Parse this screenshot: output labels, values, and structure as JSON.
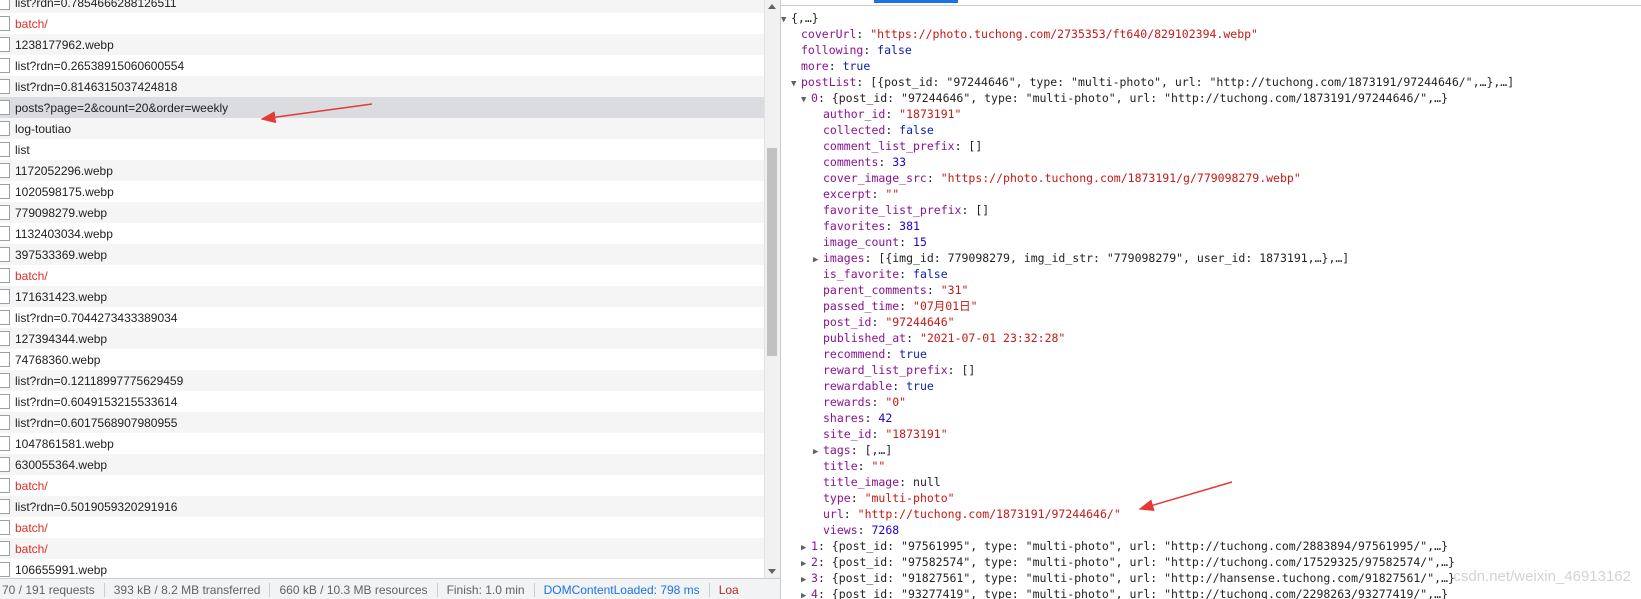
{
  "requests": [
    {
      "name": "list?rdn=0.7854666288126511"
    },
    {
      "name": "batch/",
      "red": true
    },
    {
      "name": "1238177962.webp"
    },
    {
      "name": "list?rdn=0.26538915060600554"
    },
    {
      "name": "list?rdn=0.8146315037424818"
    },
    {
      "name": "posts?page=2&count=20&order=weekly",
      "selected": true
    },
    {
      "name": "log-toutiao"
    },
    {
      "name": "list"
    },
    {
      "name": "1172052296.webp"
    },
    {
      "name": "1020598175.webp"
    },
    {
      "name": "779098279.webp"
    },
    {
      "name": "1132403034.webp"
    },
    {
      "name": "397533369.webp"
    },
    {
      "name": "batch/",
      "red": true
    },
    {
      "name": "171631423.webp"
    },
    {
      "name": "list?rdn=0.7044273433389034"
    },
    {
      "name": "127394344.webp"
    },
    {
      "name": "74768360.webp"
    },
    {
      "name": "list?rdn=0.12118997775629459"
    },
    {
      "name": "list?rdn=0.6049153215533614"
    },
    {
      "name": "list?rdn=0.6017568907980955"
    },
    {
      "name": "1047861581.webp"
    },
    {
      "name": "630055364.webp"
    },
    {
      "name": "batch/",
      "red": true
    },
    {
      "name": "list?rdn=0.5019059320291916"
    },
    {
      "name": "batch/",
      "red": true
    },
    {
      "name": "batch/",
      "red": true
    },
    {
      "name": "106655991.webp"
    }
  ],
  "status_bar": {
    "requests": "70 / 191 requests",
    "transferred": "393 kB / 8.2 MB transferred",
    "resources": "660 kB / 10.3 MB resources",
    "finish": "Finish: 1.0 min",
    "dom_content_loaded": "DOMContentLoaded: 798 ms",
    "load": "Loa"
  },
  "json_lines": [
    {
      "indent": 0,
      "toggle": "▼",
      "key": "",
      "value": "{,…}",
      "vclass": ""
    },
    {
      "indent": 1,
      "toggle": "",
      "key": "coverUrl",
      "value": "\"https://photo.tuchong.com/2735353/ft640/829102394.webp\"",
      "vclass": "str"
    },
    {
      "indent": 1,
      "toggle": "",
      "key": "following",
      "value": "false",
      "vclass": "kw"
    },
    {
      "indent": 1,
      "toggle": "",
      "key": "more",
      "value": "true",
      "vclass": "kw"
    },
    {
      "indent": 1,
      "toggle": "▼",
      "key": "postList",
      "value": "[{post_id: \"97244646\", type: \"multi-photo\", url: \"http://tuchong.com/1873191/97244646/\",…},…]",
      "vclass": ""
    },
    {
      "indent": 2,
      "toggle": "▼",
      "key": "0",
      "value": "{post_id: \"97244646\", type: \"multi-photo\", url: \"http://tuchong.com/1873191/97244646/\",…}",
      "vclass": ""
    },
    {
      "indent": 3,
      "toggle": "",
      "key": "author_id",
      "value": "\"1873191\"",
      "vclass": "str"
    },
    {
      "indent": 3,
      "toggle": "",
      "key": "collected",
      "value": "false",
      "vclass": "kw"
    },
    {
      "indent": 3,
      "toggle": "",
      "key": "comment_list_prefix",
      "value": "[]",
      "vclass": ""
    },
    {
      "indent": 3,
      "toggle": "",
      "key": "comments",
      "value": "33",
      "vclass": "num"
    },
    {
      "indent": 3,
      "toggle": "",
      "key": "cover_image_src",
      "value": "\"https://photo.tuchong.com/1873191/g/779098279.webp\"",
      "vclass": "str"
    },
    {
      "indent": 3,
      "toggle": "",
      "key": "excerpt",
      "value": "\"\"",
      "vclass": "str"
    },
    {
      "indent": 3,
      "toggle": "",
      "key": "favorite_list_prefix",
      "value": "[]",
      "vclass": ""
    },
    {
      "indent": 3,
      "toggle": "",
      "key": "favorites",
      "value": "381",
      "vclass": "num"
    },
    {
      "indent": 3,
      "toggle": "",
      "key": "image_count",
      "value": "15",
      "vclass": "num"
    },
    {
      "indent": 3,
      "toggle": "▶",
      "key": "images",
      "value": "[{img_id: 779098279, img_id_str: \"779098279\", user_id: 1873191,…},…]",
      "vclass": ""
    },
    {
      "indent": 3,
      "toggle": "",
      "key": "is_favorite",
      "value": "false",
      "vclass": "kw"
    },
    {
      "indent": 3,
      "toggle": "",
      "key": "parent_comments",
      "value": "\"31\"",
      "vclass": "str"
    },
    {
      "indent": 3,
      "toggle": "",
      "key": "passed_time",
      "value": "\"07月01日\"",
      "vclass": "str"
    },
    {
      "indent": 3,
      "toggle": "",
      "key": "post_id",
      "value": "\"97244646\"",
      "vclass": "str"
    },
    {
      "indent": 3,
      "toggle": "",
      "key": "published_at",
      "value": "\"2021-07-01 23:32:28\"",
      "vclass": "str"
    },
    {
      "indent": 3,
      "toggle": "",
      "key": "recommend",
      "value": "true",
      "vclass": "kw"
    },
    {
      "indent": 3,
      "toggle": "",
      "key": "reward_list_prefix",
      "value": "[]",
      "vclass": ""
    },
    {
      "indent": 3,
      "toggle": "",
      "key": "rewardable",
      "value": "true",
      "vclass": "kw"
    },
    {
      "indent": 3,
      "toggle": "",
      "key": "rewards",
      "value": "\"0\"",
      "vclass": "str"
    },
    {
      "indent": 3,
      "toggle": "",
      "key": "shares",
      "value": "42",
      "vclass": "num"
    },
    {
      "indent": 3,
      "toggle": "",
      "key": "site_id",
      "value": "\"1873191\"",
      "vclass": "str"
    },
    {
      "indent": 3,
      "toggle": "▶",
      "key": "tags",
      "value": "[,…]",
      "vclass": ""
    },
    {
      "indent": 3,
      "toggle": "",
      "key": "title",
      "value": "\"\"",
      "vclass": "str"
    },
    {
      "indent": 3,
      "toggle": "",
      "key": "title_image",
      "value": "null",
      "vclass": ""
    },
    {
      "indent": 3,
      "toggle": "",
      "key": "type",
      "value": "\"multi-photo\"",
      "vclass": "str"
    },
    {
      "indent": 3,
      "toggle": "",
      "key": "url",
      "value": "\"http://tuchong.com/1873191/97244646/\"",
      "vclass": "str"
    },
    {
      "indent": 3,
      "toggle": "",
      "key": "views",
      "value": "7268",
      "vclass": "num"
    },
    {
      "indent": 2,
      "toggle": "▶",
      "key": "1",
      "value": "{post_id: \"97561995\", type: \"multi-photo\", url: \"http://tuchong.com/2883894/97561995/\",…}",
      "vclass": ""
    },
    {
      "indent": 2,
      "toggle": "▶",
      "key": "2",
      "value": "{post_id: \"97582574\", type: \"multi-photo\", url: \"http://tuchong.com/17529325/97582574/\",…}",
      "vclass": ""
    },
    {
      "indent": 2,
      "toggle": "▶",
      "key": "3",
      "value": "{post_id: \"91827561\", type: \"multi-photo\", url: \"http://hansense.tuchong.com/91827561/\",…}",
      "vclass": ""
    },
    {
      "indent": 2,
      "toggle": "▶",
      "key": "4",
      "value": "{post_id: \"93277419\", type: \"multi-photo\", url: \"http://tuchong.com/2298263/93277419/\",…}",
      "vclass": ""
    }
  ],
  "watermark": "csdn.net/weixin_46913162"
}
